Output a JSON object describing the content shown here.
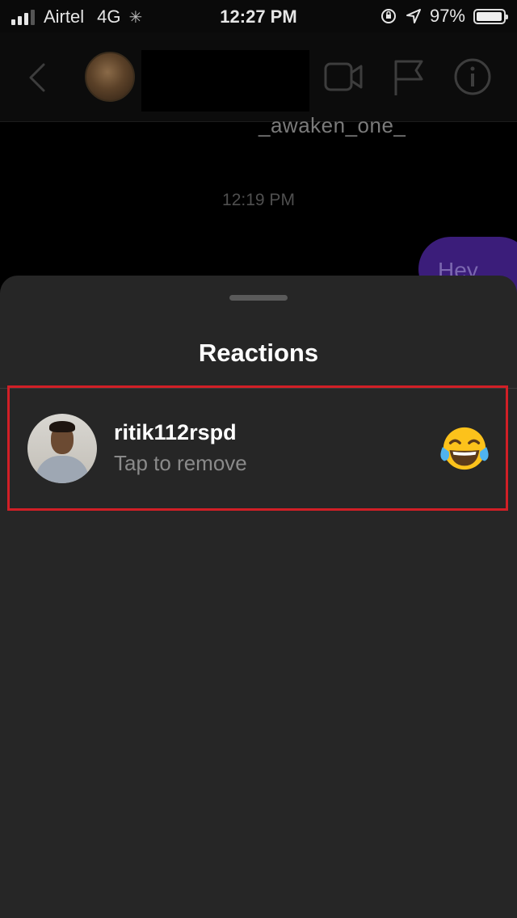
{
  "status": {
    "carrier": "Airtel",
    "network": "4G",
    "time": "12:27 PM",
    "battery": "97%",
    "battery_level": 0.97
  },
  "header": {
    "icons": [
      "back-chevron-icon",
      "video-call-icon",
      "flag-icon",
      "info-icon"
    ]
  },
  "chat": {
    "username": "_awaken_one_",
    "timestamp": "12:19 PM",
    "message": "Hey"
  },
  "sheet": {
    "title": "Reactions",
    "reactions": [
      {
        "username": "ritik112rspd",
        "hint": "Tap to remove",
        "emoji": "face-with-tears-of-joy"
      }
    ]
  },
  "colors": {
    "highlight": "#d11f26",
    "sheet_bg": "#262626",
    "bubble": "#3b1d7a"
  }
}
